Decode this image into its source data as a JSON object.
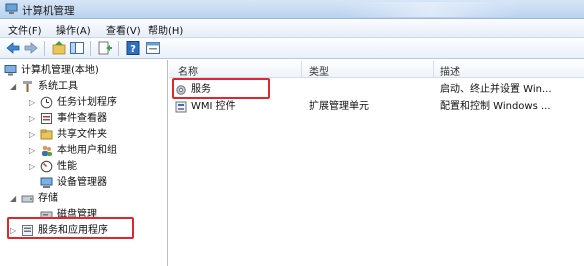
{
  "window": {
    "title": "计算机管理"
  },
  "menu": [
    "文件(F)",
    "操作(A)",
    "查看(V)",
    "帮助(H)"
  ],
  "toolbar": {
    "icons": [
      "back-arrow-icon",
      "forward-arrow-icon",
      "up-folder-icon",
      "show-hide-tree-icon",
      "export-list-icon",
      "help-icon",
      "properties-icon"
    ]
  },
  "tree": {
    "root": "计算机管理(本地)",
    "system_tools": "系统工具",
    "task_scheduler": "任务计划程序",
    "event_viewer": "事件查看器",
    "shared_folders": "共享文件夹",
    "local_users": "本地用户和组",
    "performance": "性能",
    "device_manager": "设备管理器",
    "storage": "存储",
    "disk_management": "磁盘管理",
    "services_apps": "服务和应用程序"
  },
  "list": {
    "columns": {
      "name": "名称",
      "type": "类型",
      "description": "描述"
    },
    "rows": [
      {
        "name": "服务",
        "type": "",
        "description": "启动、终止并设置 Win..."
      },
      {
        "name": "WMI 控件",
        "type": "扩展管理单元",
        "description": "配置和控制 Windows ..."
      }
    ]
  },
  "highlight_color": "#e3262b"
}
